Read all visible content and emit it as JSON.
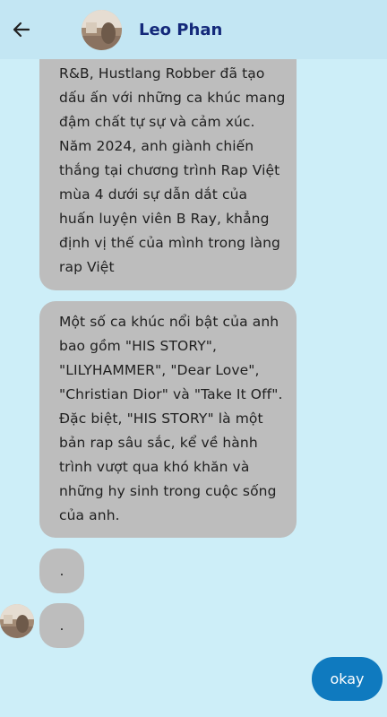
{
  "header": {
    "back_icon": "arrow-left-icon",
    "contact_name": "Leo Phan",
    "background": "#c3e6f3",
    "name_color": "#14297a"
  },
  "messages": {
    "received_1": {
      "lines": [
        "R&B, Hustlang Robber đã tạo",
        "dấu ấn với những ca khúc mang",
        "đậm chất tự sự và cảm xúc.",
        "Năm 2024, anh giành chiến",
        "thắng tại chương trình Rap Việt",
        "mùa 4 dưới sự dẫn dắt của",
        "huấn luyện viên B Ray, khẳng",
        "định vị thế của mình trong làng",
        "rap Việt"
      ]
    },
    "received_2": {
      "lines": [
        "Một số ca khúc nổi bật của anh",
        "bao gồm \"HIS STORY\",",
        "\"LILYHAMMER\", \"Dear Love\",",
        "\"Christian Dior\" và \"Take It Off\".",
        "Đặc biệt, \"HIS STORY\" là một",
        "bản rap sâu sắc, kể về hành",
        "trình vượt qua khó khăn và",
        "những hy sinh trong cuộc sống",
        "của anh."
      ]
    },
    "received_3": {
      "text": "."
    },
    "received_4": {
      "text": "."
    },
    "sent_1": {
      "text": "okay"
    }
  },
  "colors": {
    "screen_background": "#cdeef8",
    "received_bubble": "#bdbdbd",
    "sent_bubble": "#0f7abf"
  }
}
